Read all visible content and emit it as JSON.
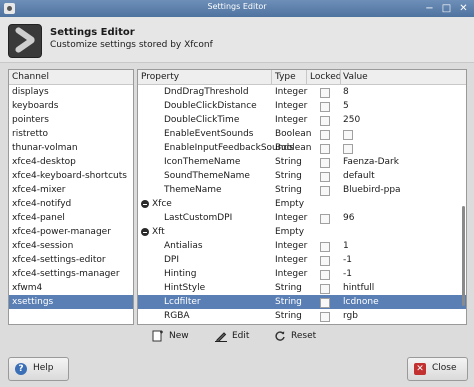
{
  "window": {
    "title": "Settings Editor",
    "minimize_glyph": "−",
    "maximize_glyph": "□",
    "close_glyph": "✕"
  },
  "header": {
    "title": "Settings Editor",
    "subtitle": "Customize settings stored by Xfconf"
  },
  "channels": {
    "header": "Channel",
    "items": [
      "displays",
      "keyboards",
      "pointers",
      "ristretto",
      "thunar-volman",
      "xfce4-desktop",
      "xfce4-keyboard-shortcuts",
      "xfce4-mixer",
      "xfce4-notifyd",
      "xfce4-panel",
      "xfce4-power-manager",
      "xfce4-session",
      "xfce4-settings-editor",
      "xfce4-settings-manager",
      "xfwm4",
      "xsettings"
    ],
    "selected": "xsettings"
  },
  "properties": {
    "columns": {
      "property": "Property",
      "type": "Type",
      "locked": "Locked",
      "value": "Value"
    },
    "rows": [
      {
        "name": "DndDragThreshold",
        "type": "Integer",
        "value": "8"
      },
      {
        "name": "DoubleClickDistance",
        "type": "Integer",
        "value": "5"
      },
      {
        "name": "DoubleClickTime",
        "type": "Integer",
        "value": "250"
      },
      {
        "name": "EnableEventSounds",
        "type": "Boolean",
        "value": ""
      },
      {
        "name": "EnableInputFeedbackSounds",
        "type": "Boolean",
        "value": ""
      },
      {
        "name": "IconThemeName",
        "type": "String",
        "value": "Faenza-Dark"
      },
      {
        "name": "SoundThemeName",
        "type": "String",
        "value": "default"
      },
      {
        "name": "ThemeName",
        "type": "String",
        "value": "Bluebird-ppa"
      },
      {
        "name": "Xfce",
        "type": "Empty",
        "value": ""
      },
      {
        "name": "LastCustomDPI",
        "type": "Integer",
        "value": "96"
      },
      {
        "name": "Xft",
        "type": "Empty",
        "value": ""
      },
      {
        "name": "Antialias",
        "type": "Integer",
        "value": "1"
      },
      {
        "name": "DPI",
        "type": "Integer",
        "value": "-1"
      },
      {
        "name": "Hinting",
        "type": "Integer",
        "value": "-1"
      },
      {
        "name": "HintStyle",
        "type": "String",
        "value": "hintfull"
      },
      {
        "name": "Lcdfilter",
        "type": "String",
        "value": "lcdnone"
      },
      {
        "name": "RGBA",
        "type": "String",
        "value": "rgb"
      }
    ],
    "selected": "Lcdfilter"
  },
  "actions": {
    "new": "New",
    "edit": "Edit",
    "reset": "Reset"
  },
  "footer": {
    "help": "Help",
    "close": "Close"
  },
  "colors": {
    "selection": "#5a7fb5",
    "titlebar": "#4f73a0",
    "help_icon": "#3b6fb6",
    "close_icon": "#c23030"
  }
}
